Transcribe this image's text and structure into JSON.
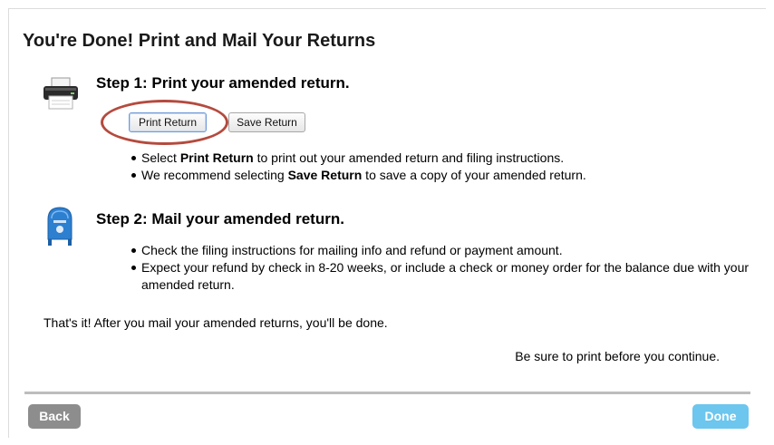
{
  "page": {
    "title": "You're Done! Print and Mail Your Returns"
  },
  "step1": {
    "icon": "printer-icon",
    "title": "Step 1: Print your amended return.",
    "buttons": {
      "print_label": "Print Return",
      "save_label": "Save Return"
    },
    "bullets": [
      {
        "pre": "Select ",
        "bold": "Print Return",
        "post": " to print out your amended return and filing instructions."
      },
      {
        "pre": "We recommend selecting ",
        "bold": "Save Return",
        "post": " to save a copy of your amended return."
      }
    ]
  },
  "step2": {
    "icon": "mailbox-icon",
    "title": "Step 2: Mail your amended return.",
    "bullets": [
      "Check the filing instructions for mailing info and refund or payment amount.",
      "Expect your refund by check in 8-20 weeks, or include a check or money order for the balance due with your amended return."
    ]
  },
  "closing_text": "That's it! After you mail your amended returns, you'll be done.",
  "print_note": "Be sure to print before you continue.",
  "nav": {
    "back_label": "Back",
    "done_label": "Done"
  },
  "colors": {
    "highlight_ring": "#b54a3e",
    "done_button": "#6cc6ee",
    "back_button": "#8d8d8d",
    "mailbox_blue": "#2d7fd0"
  }
}
